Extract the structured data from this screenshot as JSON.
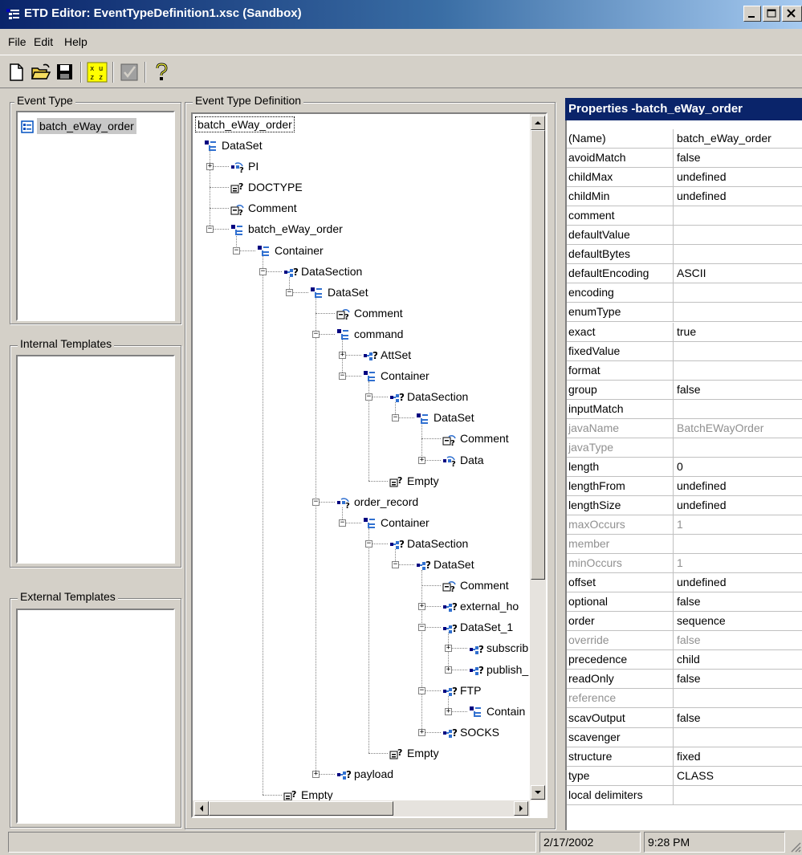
{
  "window": {
    "title": "ETD Editor: EventTypeDefinition1.xsc (Sandbox)"
  },
  "menu": [
    "File",
    "Edit",
    "Help"
  ],
  "toolbar": [
    "new-icon",
    "open-icon",
    "save-icon",
    "compile-icon",
    "check-icon",
    "help-icon"
  ],
  "panels": {
    "event_type": {
      "label": "Event Type",
      "items": [
        "batch_eWay_order"
      ]
    },
    "internal_templates": {
      "label": "Internal Templates"
    },
    "external_templates": {
      "label": "External Templates"
    },
    "definition": {
      "label": "Event Type Definition"
    }
  },
  "tree": {
    "root": "batch_eWay_order",
    "nodes": [
      {
        "label": "DataSet",
        "depth": 0,
        "icon": "dataset",
        "expander": "none"
      },
      {
        "label": "PI",
        "depth": 1,
        "icon": "choice",
        "expander": "plus"
      },
      {
        "label": "DOCTYPE",
        "depth": 1,
        "icon": "field",
        "expander": "none"
      },
      {
        "label": "Comment",
        "depth": 1,
        "icon": "comment",
        "expander": "none"
      },
      {
        "label": "batch_eWay_order",
        "depth": 1,
        "icon": "dataset",
        "expander": "minus"
      },
      {
        "label": "Container",
        "depth": 2,
        "icon": "dataset",
        "expander": "minus"
      },
      {
        "label": "DataSection",
        "depth": 3,
        "icon": "node",
        "expander": "minus"
      },
      {
        "label": "DataSet",
        "depth": 4,
        "icon": "dataset",
        "expander": "minus"
      },
      {
        "label": "Comment",
        "depth": 5,
        "icon": "comment",
        "expander": "none"
      },
      {
        "label": "command",
        "depth": 5,
        "icon": "dataset",
        "expander": "minus"
      },
      {
        "label": "AttSet",
        "depth": 6,
        "icon": "node",
        "expander": "plus"
      },
      {
        "label": "Container",
        "depth": 6,
        "icon": "dataset",
        "expander": "minus"
      },
      {
        "label": "DataSection",
        "depth": 7,
        "icon": "node",
        "expander": "minus"
      },
      {
        "label": "DataSet",
        "depth": 8,
        "icon": "dataset",
        "expander": "minus"
      },
      {
        "label": "Comment",
        "depth": 9,
        "icon": "comment",
        "expander": "none"
      },
      {
        "label": "Data",
        "depth": 9,
        "icon": "choice",
        "expander": "plus"
      },
      {
        "label": "Empty",
        "depth": 7,
        "icon": "field",
        "expander": "none"
      },
      {
        "label": "order_record",
        "depth": 5,
        "icon": "choice",
        "expander": "minus"
      },
      {
        "label": "Container",
        "depth": 6,
        "icon": "dataset",
        "expander": "minus"
      },
      {
        "label": "DataSection",
        "depth": 7,
        "icon": "node",
        "expander": "minus"
      },
      {
        "label": "DataSet",
        "depth": 8,
        "icon": "node",
        "expander": "minus"
      },
      {
        "label": "Comment",
        "depth": 9,
        "icon": "comment",
        "expander": "none"
      },
      {
        "label": "external_ho",
        "depth": 9,
        "icon": "node",
        "expander": "plus"
      },
      {
        "label": "DataSet_1",
        "depth": 9,
        "icon": "node",
        "expander": "minus"
      },
      {
        "label": "subscrib",
        "depth": 10,
        "icon": "node",
        "expander": "plus"
      },
      {
        "label": "publish_",
        "depth": 10,
        "icon": "node",
        "expander": "plus"
      },
      {
        "label": "FTP",
        "depth": 9,
        "icon": "node",
        "expander": "minus"
      },
      {
        "label": "Contain",
        "depth": 10,
        "icon": "dataset",
        "expander": "plus"
      },
      {
        "label": "SOCKS",
        "depth": 9,
        "icon": "node",
        "expander": "plus"
      },
      {
        "label": "Empty",
        "depth": 7,
        "icon": "field",
        "expander": "none"
      },
      {
        "label": "payload",
        "depth": 5,
        "icon": "node",
        "expander": "plus"
      },
      {
        "label": "Empty",
        "depth": 3,
        "icon": "field",
        "expander": "none"
      }
    ]
  },
  "properties": {
    "title": "Properties -batch_eWay_order",
    "rows": [
      {
        "name": "(Name)",
        "value": "batch_eWay_order",
        "disabled": false
      },
      {
        "name": "avoidMatch",
        "value": "false",
        "disabled": false
      },
      {
        "name": "childMax",
        "value": "undefined",
        "disabled": false
      },
      {
        "name": "childMin",
        "value": "undefined",
        "disabled": false
      },
      {
        "name": "comment",
        "value": "",
        "disabled": false
      },
      {
        "name": "defaultValue",
        "value": "",
        "disabled": false
      },
      {
        "name": "defaultBytes",
        "value": "",
        "disabled": false
      },
      {
        "name": "defaultEncoding",
        "value": "ASCII",
        "disabled": false
      },
      {
        "name": "encoding",
        "value": "",
        "disabled": false
      },
      {
        "name": "enumType",
        "value": "",
        "disabled": false
      },
      {
        "name": "exact",
        "value": "true",
        "disabled": false
      },
      {
        "name": "fixedValue",
        "value": "",
        "disabled": false
      },
      {
        "name": "format",
        "value": "",
        "disabled": false
      },
      {
        "name": "group",
        "value": "false",
        "disabled": false
      },
      {
        "name": "inputMatch",
        "value": "",
        "disabled": false
      },
      {
        "name": "javaName",
        "value": "BatchEWayOrder",
        "disabled": true
      },
      {
        "name": "javaType",
        "value": "",
        "disabled": true
      },
      {
        "name": "length",
        "value": "0",
        "disabled": false
      },
      {
        "name": "lengthFrom",
        "value": "undefined",
        "disabled": false
      },
      {
        "name": "lengthSize",
        "value": "undefined",
        "disabled": false
      },
      {
        "name": "maxOccurs",
        "value": "1",
        "disabled": true
      },
      {
        "name": "member",
        "value": "",
        "disabled": true
      },
      {
        "name": "minOccurs",
        "value": "1",
        "disabled": true
      },
      {
        "name": "offset",
        "value": "undefined",
        "disabled": false
      },
      {
        "name": "optional",
        "value": "false",
        "disabled": false
      },
      {
        "name": "order",
        "value": "sequence",
        "disabled": false
      },
      {
        "name": "override",
        "value": "false",
        "disabled": true
      },
      {
        "name": "precedence",
        "value": "child",
        "disabled": false
      },
      {
        "name": "readOnly",
        "value": "false",
        "disabled": false
      },
      {
        "name": "reference",
        "value": "",
        "disabled": true
      },
      {
        "name": "scavOutput",
        "value": "false",
        "disabled": false
      },
      {
        "name": "scavenger",
        "value": "",
        "disabled": false
      },
      {
        "name": "structure",
        "value": "fixed",
        "disabled": false
      },
      {
        "name": "type",
        "value": "CLASS",
        "disabled": false
      },
      {
        "name": "local delimiters",
        "value": "",
        "disabled": false
      }
    ]
  },
  "status": {
    "date": "2/17/2002",
    "time": "9:28 PM"
  }
}
